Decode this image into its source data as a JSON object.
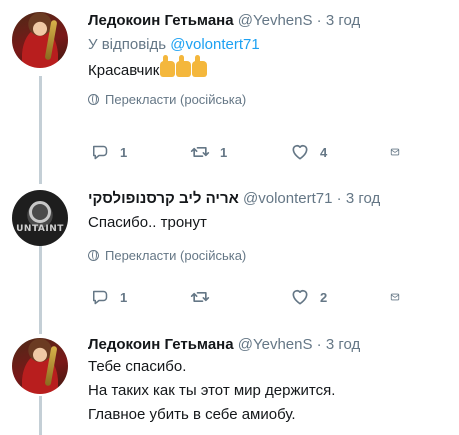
{
  "tweets": [
    {
      "name": "Ледокоин Гетьмана",
      "handle": "@YevhenS",
      "separator": "·",
      "time": "3 год",
      "reply_prefix": "У відповідь",
      "reply_mention": "@volontert71",
      "text": "Красавчик",
      "emoji": "thumbs-up x3",
      "translate": "Перекласти (російська)",
      "replies": "1",
      "retweets": "1",
      "likes": "4"
    },
    {
      "name": "אריה ליב קרסנופולסקי",
      "handle": "@volontert71",
      "separator": "·",
      "time": "3 год",
      "text": "Спасибо.. тронут",
      "avatar_text": "UNTAINT",
      "translate": "Перекласти (російська)",
      "replies": "1",
      "retweets": "",
      "likes": "2"
    },
    {
      "name": "Ледокоин Гетьмана",
      "handle": "@YevhenS",
      "separator": "·",
      "time": "3 год",
      "text_lines": [
        "Тебе спасибо.",
        "На таких как ты этот мир держится.",
        "Главное убить в себе амиобу."
      ]
    }
  ],
  "colors": {
    "text": "#14171a",
    "secondary": "#657786",
    "link": "#1da1f2",
    "thread_line": "#c4cfd6"
  }
}
